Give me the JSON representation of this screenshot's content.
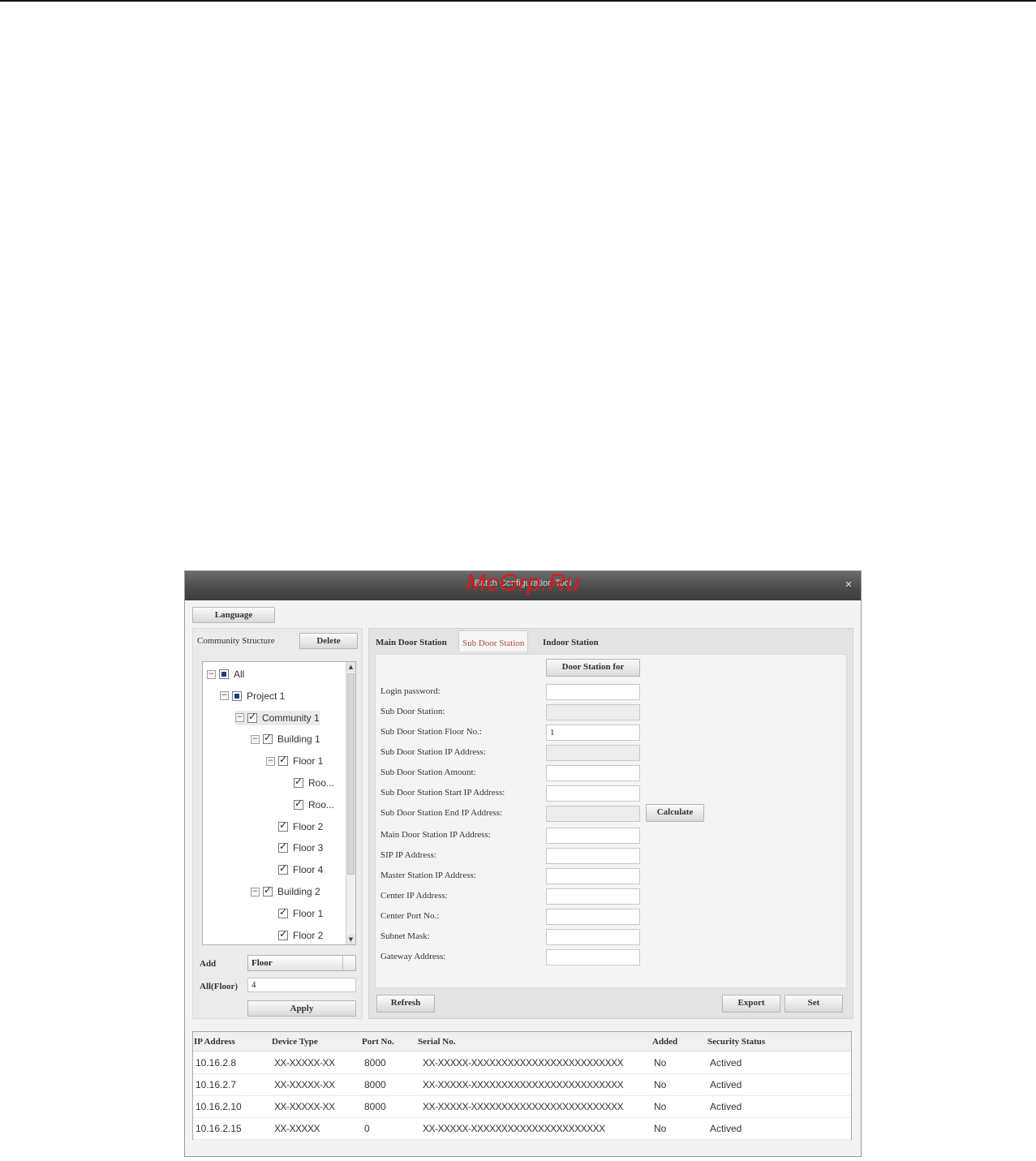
{
  "watermark": "McGrp.Ru",
  "window": {
    "title": "Batch Configuration Tool",
    "close_icon": "close-icon"
  },
  "toolbar": {
    "language_label": "Language"
  },
  "community": {
    "title": "Community Structure",
    "delete_label": "Delete",
    "tree": [
      {
        "label": "All",
        "level": 0,
        "expander": "−",
        "check": "partial"
      },
      {
        "label": "Project 1",
        "level": 1,
        "expander": "−",
        "check": "partial"
      },
      {
        "label": "Community 1",
        "level": 2,
        "expander": "−",
        "check": "checked",
        "selected": true
      },
      {
        "label": "Building 1",
        "level": 3,
        "expander": "−",
        "check": "checked"
      },
      {
        "label": "Floor 1",
        "level": 4,
        "expander": "−",
        "check": "checked"
      },
      {
        "label": "Roo...",
        "level": 5,
        "expander": "",
        "check": "checked"
      },
      {
        "label": "Roo...",
        "level": 5,
        "expander": "",
        "check": "checked"
      },
      {
        "label": "Floor 2",
        "level": 4,
        "expander": "",
        "check": "checked"
      },
      {
        "label": "Floor 3",
        "level": 4,
        "expander": "",
        "check": "checked"
      },
      {
        "label": "Floor 4",
        "level": 4,
        "expander": "",
        "check": "checked"
      },
      {
        "label": "Building 2",
        "level": 3,
        "expander": "−",
        "check": "checked"
      },
      {
        "label": "Floor 1",
        "level": 4,
        "expander": "",
        "check": "checked"
      },
      {
        "label": "Floor 2",
        "level": 4,
        "expander": "",
        "check": "checked"
      }
    ],
    "add_label": "Add",
    "add_type": "Floor",
    "all_label": "All(Floor)",
    "all_value": "4",
    "apply_label": "Apply"
  },
  "tabs": [
    {
      "label": "Main Door Station",
      "active": false
    },
    {
      "label": "Sub Door Station",
      "active": true
    },
    {
      "label": "Indoor Station",
      "active": false
    }
  ],
  "form": {
    "door_station_for_label": "Door Station for",
    "calculate_label": "Calculate",
    "fields": [
      {
        "label": "Login password:",
        "value": "",
        "disabled": false
      },
      {
        "label": "Sub Door Station:",
        "value": "",
        "disabled": true
      },
      {
        "label": "Sub Door Station Floor No.:",
        "value": "1",
        "disabled": false
      },
      {
        "label": "Sub Door Station IP Address:",
        "value": "",
        "disabled": true
      },
      {
        "label": "Sub Door Station Amount:",
        "value": "",
        "disabled": false
      },
      {
        "label": "Sub Door Station Start IP Address:",
        "value": "",
        "disabled": false
      },
      {
        "label": "Sub Door Station End IP Address:",
        "value": "",
        "disabled": true
      },
      {
        "label": "Main Door Station IP Address:",
        "value": "",
        "disabled": false
      },
      {
        "label": "SIP IP Address:",
        "value": "",
        "disabled": false
      },
      {
        "label": "Master Station IP Address:",
        "value": "",
        "disabled": false
      },
      {
        "label": "Center IP Address:",
        "value": "",
        "disabled": false
      },
      {
        "label": "Center Port No.:",
        "value": "",
        "disabled": false
      },
      {
        "label": "Subnet Mask:",
        "value": "",
        "disabled": false
      },
      {
        "label": "Gateway Address:",
        "value": "",
        "disabled": false
      }
    ],
    "refresh_label": "Refresh",
    "export_label": "Export",
    "set_label": "Set"
  },
  "devices": {
    "columns": [
      "IP Address",
      "Device Type",
      "Port No.",
      "Serial No.",
      "Added",
      "Security Status"
    ],
    "rows": [
      [
        "10.16.2.8",
        "XX-XXXXX-XX",
        "8000",
        "XX-XXXXX-XXXXXXXXXXXXXXXXXXXXXXXXX",
        "No",
        "Actived"
      ],
      [
        "10.16.2.7",
        "XX-XXXXX-XX",
        "8000",
        "XX-XXXXX-XXXXXXXXXXXXXXXXXXXXXXXXX",
        "No",
        "Actived"
      ],
      [
        "10.16.2.10",
        "XX-XXXXX-XX",
        "8000",
        "XX-XXXXX-XXXXXXXXXXXXXXXXXXXXXXXXX",
        "No",
        "Actived"
      ],
      [
        "10.16.2.15",
        "XX-XXXXX",
        "0",
        "XX-XXXXX-XXXXXXXXXXXXXXXXXXXXXX",
        "No",
        "Actived"
      ]
    ]
  }
}
